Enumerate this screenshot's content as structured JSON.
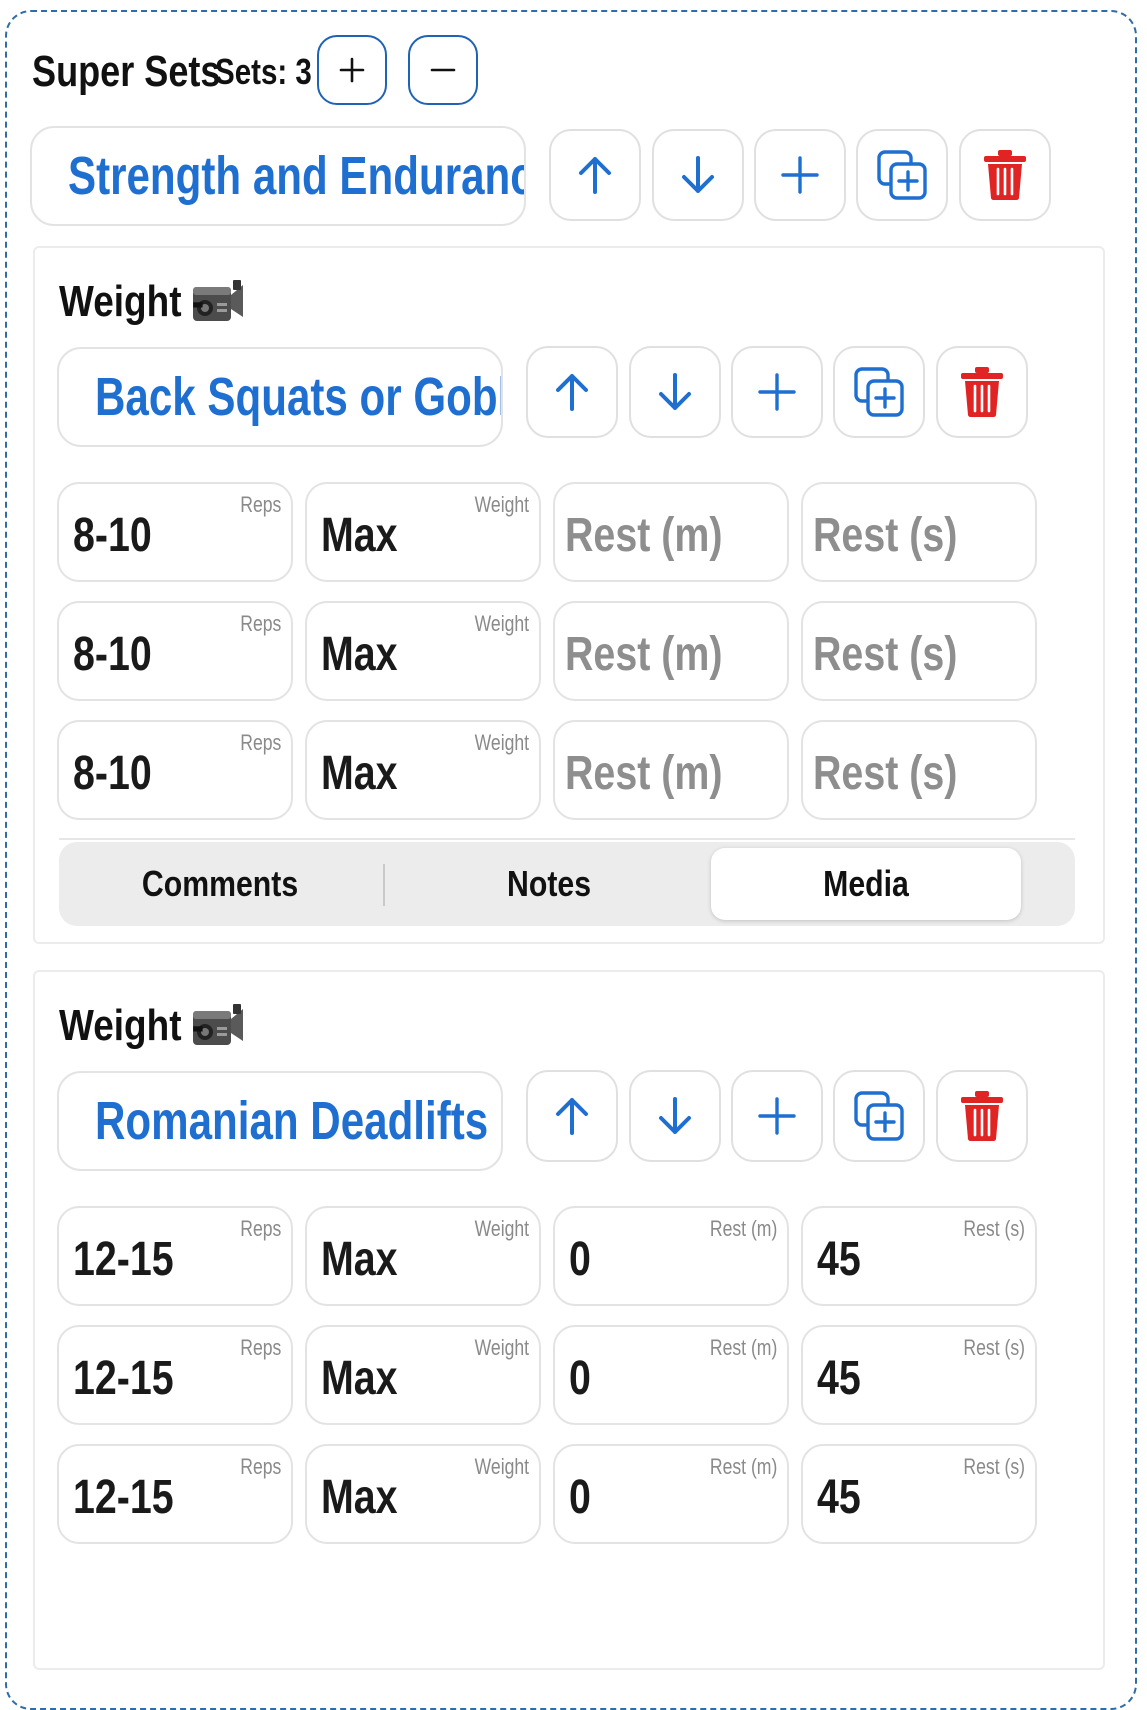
{
  "header": {
    "title": "Super Sets",
    "sets_label": "Sets: 3"
  },
  "group": {
    "name": "Strength and Endurance"
  },
  "exercises": [
    {
      "type_label": "Weight -",
      "name": "Back Squats or Goblet",
      "rows": [
        {
          "reps": "8-10",
          "weight": "Max",
          "rest_m": "",
          "rest_s": ""
        },
        {
          "reps": "8-10",
          "weight": "Max",
          "rest_m": "",
          "rest_s": ""
        },
        {
          "reps": "8-10",
          "weight": "Max",
          "rest_m": "",
          "rest_s": ""
        }
      ],
      "tabs": [
        "Comments",
        "Notes",
        "Media"
      ],
      "active_tab": "Media"
    },
    {
      "type_label": "Weight -",
      "name": "Romanian Deadlifts",
      "rows": [
        {
          "reps": "12-15",
          "weight": "Max",
          "rest_m": "0",
          "rest_s": "45"
        },
        {
          "reps": "12-15",
          "weight": "Max",
          "rest_m": "0",
          "rest_s": "45"
        },
        {
          "reps": "12-15",
          "weight": "Max",
          "rest_m": "0",
          "rest_s": "45"
        }
      ]
    }
  ],
  "field_labels": {
    "reps": "Reps",
    "weight": "Weight",
    "rest_m": "Rest (m)",
    "rest_s": "Rest (s)"
  },
  "placeholders": {
    "rest_m": "Rest (m)",
    "rest_s": "Rest (s)"
  },
  "colors": {
    "accent": "#1f6fd1",
    "delete": "#e02424",
    "frame": "#2f6da8"
  },
  "icons": [
    "plus-icon",
    "minus-icon",
    "arrow-up-icon",
    "arrow-down-icon",
    "duplicate-icon",
    "trash-icon",
    "video-camera-icon"
  ]
}
